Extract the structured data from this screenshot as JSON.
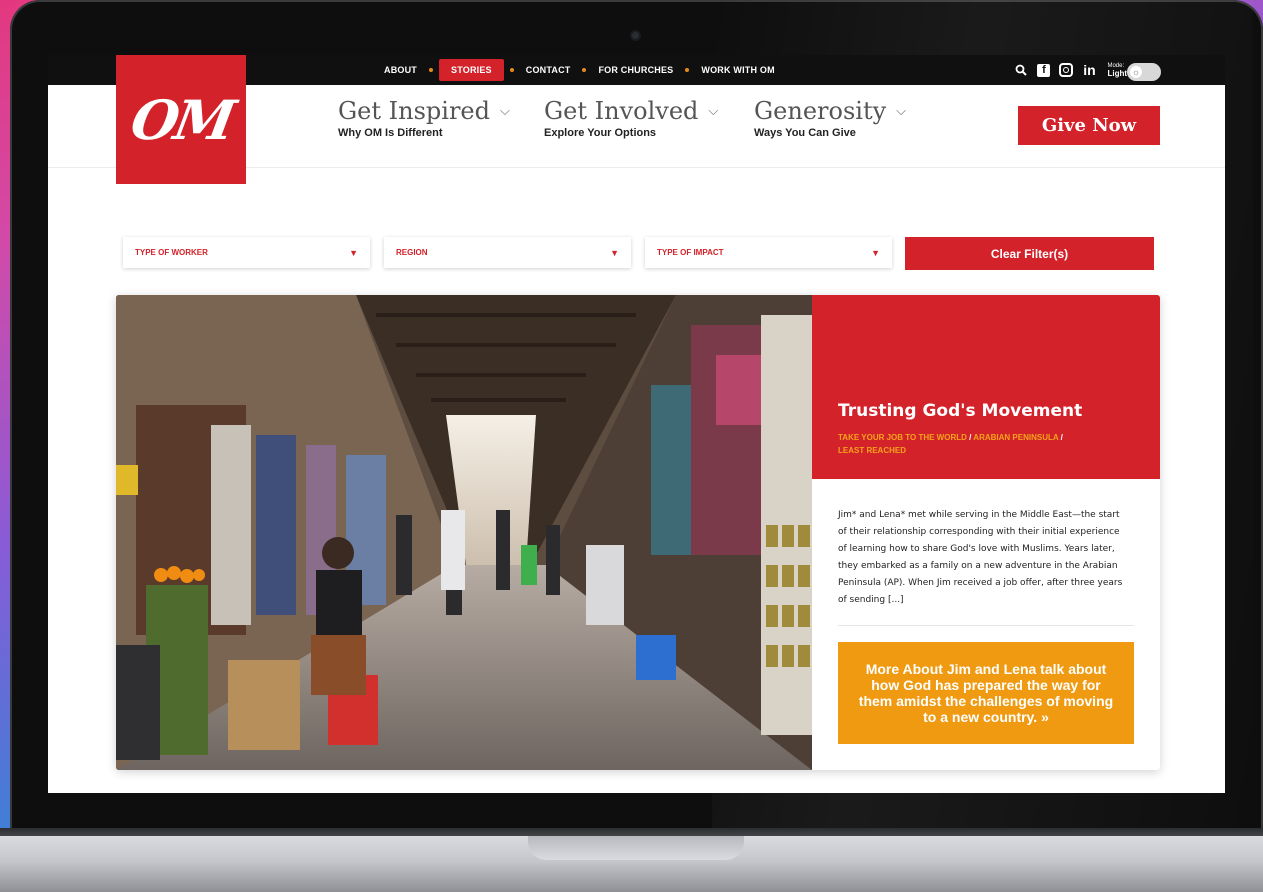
{
  "topbar": {
    "links": [
      "ABOUT",
      "STORIES",
      "CONTACT",
      "FOR CHURCHES",
      "WORK WITH OM"
    ],
    "active_link": "STORIES",
    "mode_label": "Mode:",
    "mode_value": "Light",
    "social_icons": [
      "search-icon",
      "facebook-icon",
      "instagram-icon",
      "linkedin-icon"
    ]
  },
  "logo": {
    "text": "OM",
    "color": "#d3222a"
  },
  "mainnav": {
    "items": [
      {
        "title": "Get Inspired",
        "subtitle": "Why OM Is Different"
      },
      {
        "title": "Get Involved",
        "subtitle": "Explore Your Options"
      },
      {
        "title": "Generosity",
        "subtitle": "Ways You Can Give"
      }
    ],
    "give_label": "Give Now"
  },
  "filters": {
    "worker": "TYPE OF WORKER",
    "region": "REGION",
    "impact": "TYPE OF IMPACT",
    "clear_label": "Clear Filter(s)"
  },
  "story": {
    "title": "Trusting God's Movement",
    "tags": [
      "TAKE YOUR JOB TO THE WORLD",
      "ARABIAN PENINSULA",
      "LEAST REACHED"
    ],
    "excerpt": "Jim* and Lena* met while serving in the Middle East—the start of their relationship corresponding with their initial experience of learning how to share God's love with Muslims. Years later, they embarked as a family on a new adventure in the Arabian Peninsula (AP). When Jim received a job offer, after three years of sending [...]",
    "cta": "More About Jim and Lena talk about how God has prepared the way for them amidst the challenges of moving to a new country. »"
  },
  "colors": {
    "brand_red": "#d3222a",
    "accent_orange": "#ef9a10",
    "tag_orange": "#f4a31c"
  }
}
